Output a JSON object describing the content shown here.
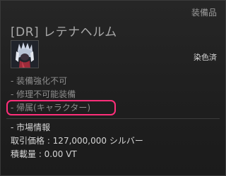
{
  "tooltip": {
    "category": "装備品",
    "item_name": "[DR] レテナヘルム",
    "dye_status": "染色済",
    "properties": [
      "- 装備強化不可",
      "- 修理不可能装備",
      "- 帰属(キャラクター)"
    ],
    "market": {
      "title": "- 市場情報",
      "price": "取引価格 : 127,000,000 シルバー",
      "weight": "積載量 : 0.00 VT"
    },
    "colors": {
      "highlight": "#ff2e7a",
      "item_name": "#a9a9a9"
    },
    "icon": "helmet-icon"
  }
}
